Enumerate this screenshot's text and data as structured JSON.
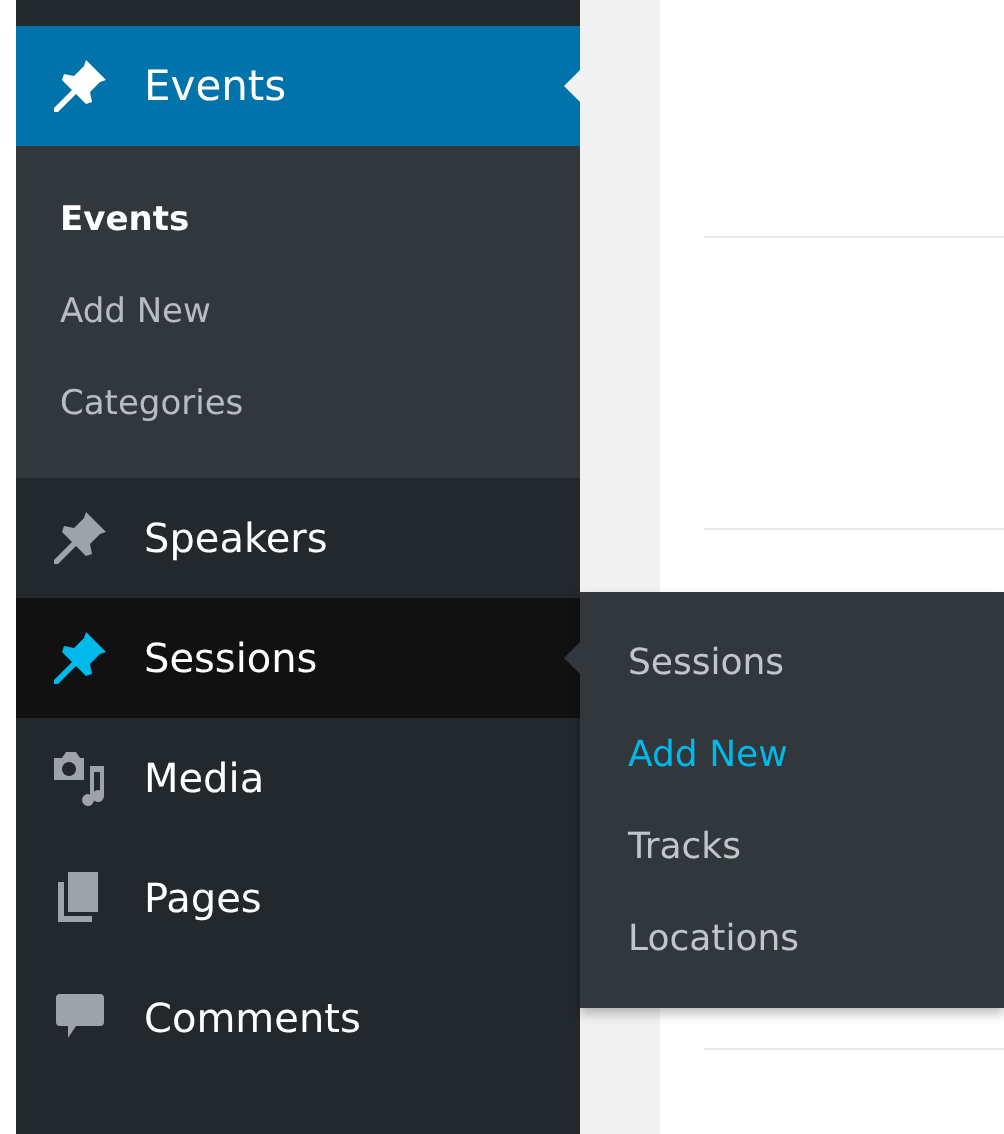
{
  "menu": [
    {
      "label": "Events",
      "current": true,
      "hovered": false,
      "submenu": [
        {
          "label": "Events",
          "selected": true
        },
        {
          "label": "Add New",
          "selected": false
        },
        {
          "label": "Categories",
          "selected": false
        }
      ]
    },
    {
      "label": "Speakers",
      "current": false,
      "hovered": false
    },
    {
      "label": "Sessions",
      "current": false,
      "hovered": true,
      "flyout": [
        {
          "label": "Sessions",
          "selected": false
        },
        {
          "label": "Add New",
          "selected": true
        },
        {
          "label": "Tracks",
          "selected": false
        },
        {
          "label": "Locations",
          "selected": false
        }
      ]
    },
    {
      "label": "Media",
      "current": false,
      "hovered": false
    },
    {
      "label": "Pages",
      "current": false,
      "hovered": false
    },
    {
      "label": "Comments",
      "current": false,
      "hovered": false
    }
  ]
}
